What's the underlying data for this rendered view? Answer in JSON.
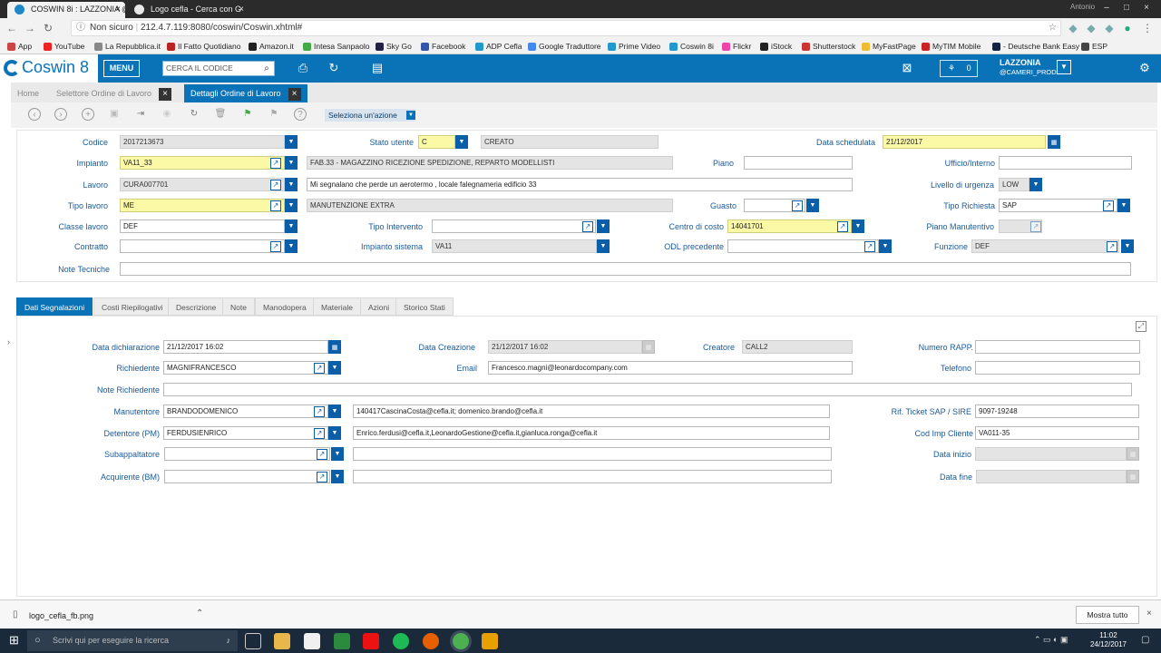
{
  "browser": {
    "tabs": [
      {
        "title": "COSWIN 8i : LAZZONIA @"
      },
      {
        "title": "Logo cefla - Cerca con G"
      }
    ],
    "security": "Non sicuro",
    "url": "212.4.7.119:8080/coswin/Coswin.xhtml#",
    "profile": "Antonio",
    "bookmarks": [
      "App",
      "YouTube",
      "La Repubblica.it",
      "Il Fatto Quotidiano",
      "Amazon.it",
      "Intesa Sanpaolo",
      "Sky Go",
      "Facebook",
      "ADP Cefla",
      "Google Traduttore",
      "Prime Video",
      "Coswin 8i",
      "Flickr",
      "iStock",
      "Shutterstock",
      "MyFastPage",
      "MyTIM Mobile",
      "- Deutsche Bank Easy",
      "ESP"
    ]
  },
  "app": {
    "logo": "Coswin 8",
    "menu_label": "MENU",
    "search_placeholder": "CERCA IL CODICE",
    "cart_count": "0",
    "user_name": "LAZZONIA",
    "user_db": "@CAMERI_PROD"
  },
  "tabs": [
    {
      "label": "Home"
    },
    {
      "label": "Selettore Ordine di Lavoro"
    },
    {
      "label": "Dettagli Ordine di Lavoro"
    }
  ],
  "toolbar": {
    "action_select": "Seleziona un'azione"
  },
  "header_form": {
    "codice_label": "Codice",
    "codice": "2017213673",
    "stato_utente_label": "Stato utente",
    "stato_utente": "C",
    "stato_desc": "CREATO",
    "data_schedulata_label": "Data schedulata",
    "data_schedulata": "21/12/2017",
    "impianto_label": "Impianto",
    "impianto": "VA11_33",
    "impianto_desc": "FAB.33 - MAGAZZINO RICEZIONE SPEDIZIONE, REPARTO MODELLISTI",
    "piano_label": "Piano",
    "piano": "",
    "ufficio_label": "Ufficio/Interno",
    "ufficio": "",
    "lavoro_label": "Lavoro",
    "lavoro": "CURA007701",
    "lavoro_desc": "Mi segnalano che perde un aerotermo , locale falegnameria edificio 33",
    "urgenza_label": "Livello di urgenza",
    "urgenza": "LOW",
    "tipo_lavoro_label": "Tipo lavoro",
    "tipo_lavoro": "ME",
    "tipo_lavoro_desc": "MANUTENZIONE EXTRA",
    "guasto_label": "Guasto",
    "guasto": "",
    "tipo_richiesta_label": "Tipo Richiesta",
    "tipo_richiesta": "SAP",
    "classe_lavoro_label": "Classe lavoro",
    "classe_lavoro": "DEF",
    "tipo_intervento_label": "Tipo Intervento",
    "tipo_intervento": "",
    "centro_costo_label": "Centro di costo",
    "centro_costo": "14041701",
    "piano_manutentivo_label": "Piano Manutentivo",
    "piano_manutentivo": "",
    "contratto_label": "Contratto",
    "contratto": "",
    "impianto_sistema_label": "Impianto sistema",
    "impianto_sistema": "VA11",
    "odl_precedente_label": "ODL precedente",
    "odl_precedente": "",
    "funzione_label": "Funzione",
    "funzione": "DEF",
    "note_tecniche_label": "Note Tecniche",
    "note_tecniche": ""
  },
  "subtabs": [
    {
      "label": "Dati Segnalazioni"
    },
    {
      "label": "Costi Riepilogativi"
    },
    {
      "label": "Descrizione"
    },
    {
      "label": "Note"
    },
    {
      "label": "Manodopera"
    },
    {
      "label": "Materiale"
    },
    {
      "label": "Azioni"
    },
    {
      "label": "Storico Stati"
    }
  ],
  "detail_form": {
    "data_dichiarazione_label": "Data dichiarazione",
    "data_dichiarazione": "21/12/2017 16:02",
    "data_creazione_label": "Data Creazione",
    "data_creazione": "21/12/2017 16:02",
    "creatore_label": "Creatore",
    "creatore": "CALL2",
    "numero_rapp_label": "Numero RAPP.",
    "numero_rapp": "",
    "richiedente_label": "Richiedente",
    "richiedente": "MAGNIFRANCESCO",
    "email_label": "Email",
    "email": "Francesco.magni@leonardocompany.com",
    "telefono_label": "Telefono",
    "telefono": "",
    "note_richiedente_label": "Note Richiedente",
    "note_richiedente": "",
    "manutentore_label": "Manutentore",
    "manutentore": "BRANDODOMENICO",
    "manutentore_email": "140417CascinaCosta@cefla.it; domenico.brando@cefla.it",
    "rif_ticket_label": "Rif. Ticket SAP / SIRE",
    "rif_ticket": "9097-19248",
    "detentore_label": "Detentore (PM)",
    "detentore": "FERDUSIENRICO",
    "detentore_email": "Enrico.ferdusi@cefla.it,LeonardoGestione@cefla.it,gianluca.ronga@cefla.it",
    "cod_imp_cliente_label": "Cod Imp Cliente",
    "cod_imp_cliente": "VA011-35",
    "subappaltatore_label": "Subappaltatore",
    "subappaltatore": "",
    "data_inizio_label": "Data inizio",
    "data_inizio": "",
    "acquirente_label": "Acquirente (BM)",
    "acquirente": "",
    "data_fine_label": "Data fine",
    "data_fine": ""
  },
  "downloads": {
    "file": "logo_cefla_fb.png",
    "show_all": "Mostra tutto"
  },
  "taskbar": {
    "search_placeholder": "Scrivi qui per eseguire la ricerca",
    "time": "11:02",
    "date": "24/12/2017"
  }
}
